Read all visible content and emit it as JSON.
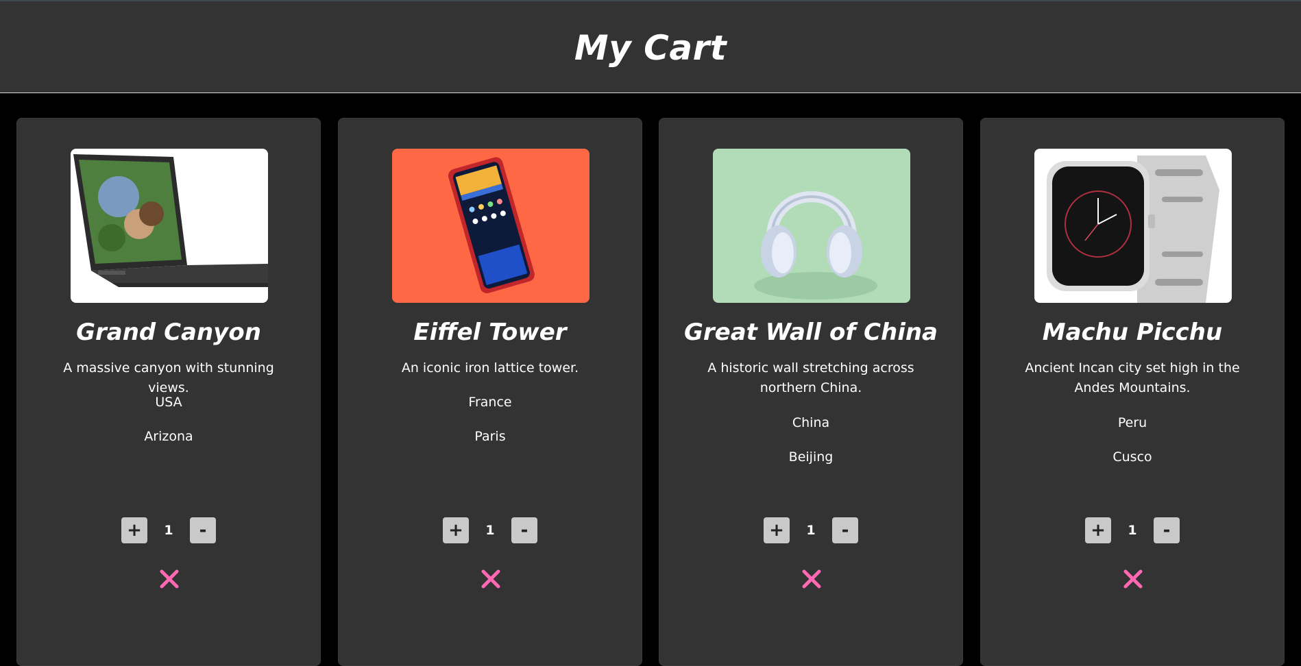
{
  "header": {
    "title": "My Cart"
  },
  "cards": [
    {
      "title": "Grand Canyon",
      "description": "A massive canyon with stunning views.",
      "country": "USA",
      "region": "Arizona",
      "quantity": "1",
      "increment_label": "+",
      "decrement_label": "-",
      "image_icon": "laptop-image"
    },
    {
      "title": "Eiffel Tower",
      "description": "An iconic iron lattice tower.",
      "country": "France",
      "region": "Paris",
      "quantity": "1",
      "increment_label": "+",
      "decrement_label": "-",
      "image_icon": "smartphone-image"
    },
    {
      "title": "Great Wall of China",
      "description": "A historic wall stretching across northern China.",
      "country": "China",
      "region": "Beijing",
      "quantity": "1",
      "increment_label": "+",
      "decrement_label": "-",
      "image_icon": "headphones-image"
    },
    {
      "title": "Machu Picchu",
      "description": "Ancient Incan city set high in the Andes Mountains.",
      "country": "Peru",
      "region": "Cusco",
      "quantity": "1",
      "increment_label": "+",
      "decrement_label": "-",
      "image_icon": "smartwatch-image"
    }
  ],
  "colors": {
    "page_bg": "#000000",
    "panel_bg": "#333333",
    "remove_icon": "#ff69b4",
    "button_bg": "#c9c9c9"
  }
}
